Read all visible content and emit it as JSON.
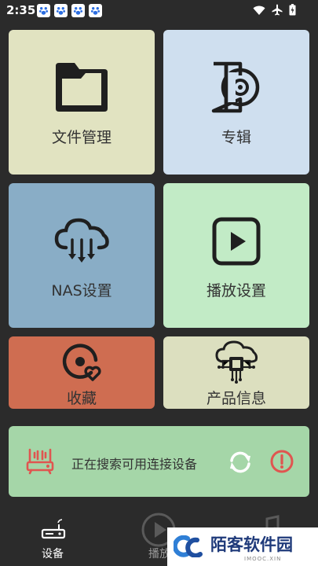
{
  "status_bar": {
    "time": "2:35"
  },
  "tiles": {
    "files": {
      "label": "文件管理",
      "icon": "folder-icon"
    },
    "album": {
      "label": "专辑",
      "icon": "album-icon"
    },
    "nas": {
      "label": "NAS设置",
      "icon": "cloud-download-icon"
    },
    "play": {
      "label": "播放设置",
      "icon": "play-icon"
    },
    "fav": {
      "label": "收藏",
      "icon": "favorite-disc-icon"
    },
    "product": {
      "label": "产品信息",
      "icon": "cloud-chip-icon"
    }
  },
  "device_bar": {
    "status_text": "正在搜索可用连接设备",
    "refresh_icon": "refresh-icon",
    "warning_icon": "alert-icon"
  },
  "bottom_nav": {
    "items": [
      {
        "label": "设备",
        "icon": "router-icon"
      },
      {
        "label": "播放",
        "icon": "play-circle-icon"
      },
      {
        "label": "",
        "icon": "music-icon"
      }
    ]
  },
  "watermark": {
    "brand": "陌客软件园",
    "sub": "IMOOC.XIN"
  },
  "colors": {
    "background": "#2b2b2b",
    "files_tile": "#e1e3c1",
    "album_tile": "#cfdfef",
    "nas_tile": "#89adc6",
    "play_tile": "#c2ebc6",
    "fav_tile": "#cf6d51",
    "product_tile": "#dcdfbf",
    "device_bar": "#a5d6a8",
    "alert": "#e05550"
  }
}
